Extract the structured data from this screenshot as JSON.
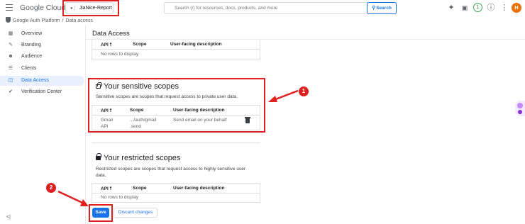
{
  "topbar": {
    "logo": {
      "google": "Google",
      "cloud": " Cloud"
    },
    "project": "JiaNice-Report",
    "search": {
      "placeholder": "Search (/) for resources, docs, products, and more",
      "button": "Search"
    },
    "notification_count": "1",
    "avatar_initial": "H"
  },
  "breadcrumb": {
    "platform": "Google Auth Platform",
    "separator": "/",
    "page": "Data access"
  },
  "sidebar": {
    "items": [
      {
        "label": "Overview",
        "icon": "overview-icon"
      },
      {
        "label": "Branding",
        "icon": "branding-icon"
      },
      {
        "label": "Audience",
        "icon": "audience-icon"
      },
      {
        "label": "Clients",
        "icon": "clients-icon"
      },
      {
        "label": "Data Access",
        "icon": "data-access-icon",
        "active": true
      },
      {
        "label": "Verification Center",
        "icon": "verification-icon"
      }
    ],
    "collapse_glyph": "<|"
  },
  "main": {
    "title": "Data Access",
    "table_headers": {
      "api": "API",
      "scope": "Scope",
      "description": "User-facing description"
    },
    "non_sensitive": {
      "empty": "No rows to display"
    },
    "sensitive": {
      "title": "Your sensitive scopes",
      "description": "Sensitive scopes are scopes that request access to private user data.",
      "rows": [
        {
          "api_line1": "Gmail",
          "api_line2": "API",
          "scope_line1": ".../auth/gmail",
          "scope_line2": ".send",
          "description": "Send email on your behalf"
        }
      ]
    },
    "restricted": {
      "title": "Your restricted scopes",
      "description_line1": "Restricted scopes are scopes that request access to highly sensitive user",
      "description_line2": "data.",
      "empty": "No rows to display"
    },
    "buttons": {
      "save": "Save",
      "discard": "Discard changes"
    }
  },
  "annotations": {
    "callout_1": "1",
    "callout_2": "2",
    "highlight_color": "#e02020"
  }
}
